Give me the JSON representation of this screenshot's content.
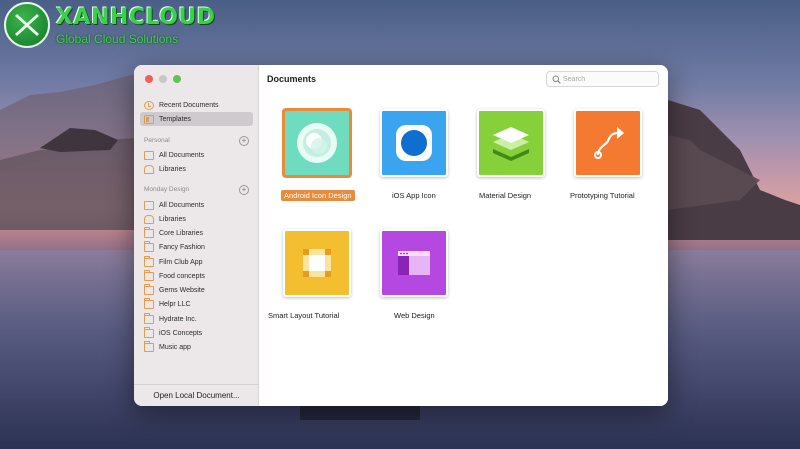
{
  "watermark": {
    "title": "XANHCLOUD",
    "subtitle": "Global Cloud Solutions"
  },
  "window": {
    "main_title": "Documents",
    "search_placeholder": "Search",
    "open_local_label": "Open Local Document...",
    "sidebar": {
      "top_items": [
        {
          "label": "Recent Documents",
          "icon": "clock-icon",
          "active": false
        },
        {
          "label": "Templates",
          "icon": "template-icon",
          "active": true
        }
      ],
      "personal": {
        "label": "Personal",
        "items": [
          {
            "label": "All Documents",
            "icon": "documents-icon"
          },
          {
            "label": "Libraries",
            "icon": "library-icon"
          }
        ]
      },
      "team": {
        "label": "Monday Design",
        "items": [
          {
            "label": "All Documents",
            "icon": "documents-icon"
          },
          {
            "label": "Libraries",
            "icon": "library-icon"
          },
          {
            "label": "Core Libraries",
            "icon": "folder-icon"
          },
          {
            "label": "Fancy Fashion",
            "icon": "folder-icon"
          },
          {
            "label": "Film Club App",
            "icon": "folder-icon"
          },
          {
            "label": "Food concepts",
            "icon": "folder-icon"
          },
          {
            "label": "Gems Website",
            "icon": "folder-icon"
          },
          {
            "label": "Helpr LLC",
            "icon": "folder-icon"
          },
          {
            "label": "Hydrate Inc.",
            "icon": "folder-icon"
          },
          {
            "label": "iOS Concepts",
            "icon": "folder-icon"
          },
          {
            "label": "Music app",
            "icon": "folder-icon"
          }
        ]
      }
    },
    "templates": [
      {
        "label": "Android Icon Design",
        "selected": true,
        "color": "#6fdcc0"
      },
      {
        "label": "iOS App Icon",
        "selected": false,
        "color": "#3aa4f0"
      },
      {
        "label": "Material Design",
        "selected": false,
        "color": "#86d13a"
      },
      {
        "label": "Prototyping Tutorial",
        "selected": false,
        "color": "#f47a32"
      },
      {
        "label": "Smart Layout Tutorial",
        "selected": false,
        "color": "#f3bf31"
      },
      {
        "label": "Web Design",
        "selected": false,
        "color": "#b448e0"
      }
    ]
  },
  "colors": {
    "accent": "#e98b3a",
    "sidebar_bg": "#ece8ea",
    "folder_icon": "#e89a4e"
  }
}
